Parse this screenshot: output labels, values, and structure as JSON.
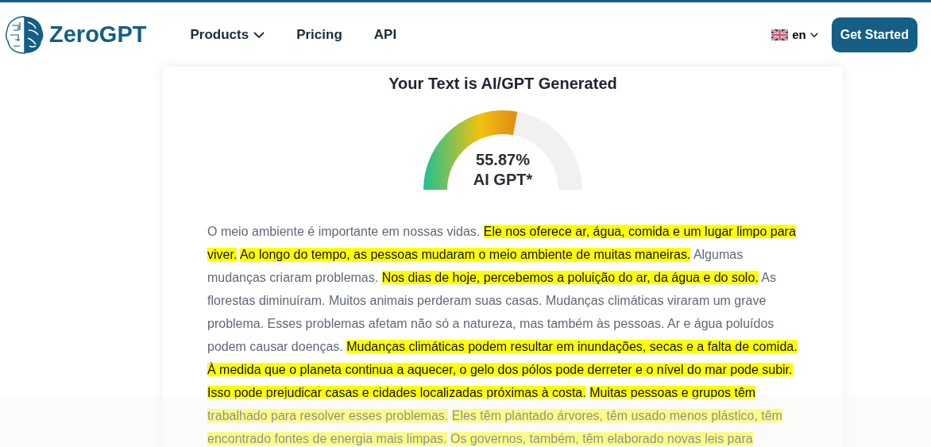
{
  "header": {
    "brand": "ZeroGPT",
    "nav": [
      {
        "label": "Products",
        "dropdown": true
      },
      {
        "label": "Pricing",
        "dropdown": false
      },
      {
        "label": "API",
        "dropdown": false
      }
    ],
    "language": "en",
    "cta": "Get Started"
  },
  "result": {
    "title": "Your Text is AI/GPT Generated",
    "gauge": {
      "level": 0.5587,
      "percent": "55.87%",
      "label": "AI GPT*"
    },
    "sentences": [
      {
        "text": "O meio ambiente é importante em nossas vidas.",
        "highlighted": false
      },
      {
        "text": "Ele nos oferece ar, água, comida e um lugar limpo para viver.",
        "highlighted": true
      },
      {
        "text": "Ao longo do tempo, as pessoas mudaram o meio ambiente de muitas maneiras.",
        "highlighted": true
      },
      {
        "text": "Algumas mudanças criaram problemas.",
        "highlighted": false
      },
      {
        "text": "Nos dias de hoje, percebemos a poluição do ar, da água e do solo.",
        "highlighted": true
      },
      {
        "text": "As florestas diminuíram. Muitos animais perderam suas casas. Mudanças climáticas viraram um grave problema. Esses problemas afetam não só a natureza, mas também às pessoas. Ar e água poluídos podem causar doenças.",
        "highlighted": false
      },
      {
        "text": "Mudanças climáticas podem resultar em inundações, secas e a falta de comida.",
        "highlighted": true
      },
      {
        "text": "À medida que o planeta continua a aquecer, o gelo dos pólos pode derreter e o nível do mar pode subir.",
        "highlighted": true
      },
      {
        "text": "Isso pode prejudicar casas e cidades localizadas próximas à costa.",
        "highlighted": true
      },
      {
        "text": "Muitas pessoas e grupos têm trabalhado para resolver esses problemas.",
        "highlighted": true
      },
      {
        "text": "Eles têm plantado árvores, têm usado menos plástico, têm encontrado fontes de energia mais limpas.",
        "highlighted": true
      },
      {
        "text": "Os governos, também, têm elaborado novas leis para",
        "highlighted": true
      }
    ]
  }
}
